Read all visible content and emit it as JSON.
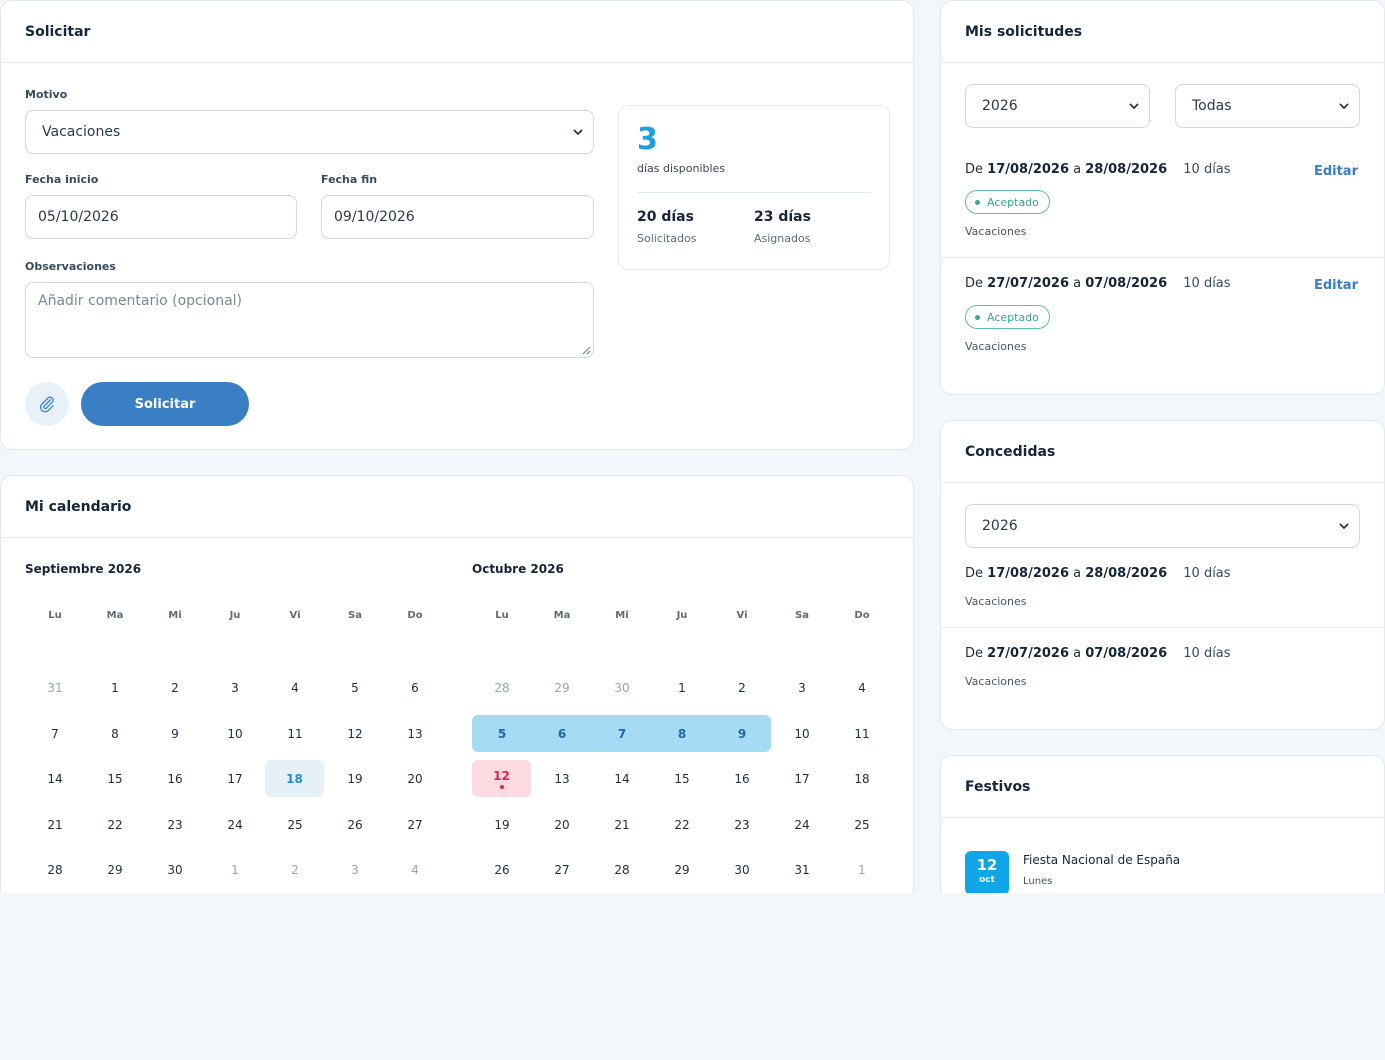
{
  "solicitar": {
    "title": "Solicitar",
    "motivo_label": "Motivo",
    "motivo_value": "Vacaciones",
    "fecha_inicio_label": "Fecha inicio",
    "fecha_inicio_value": "05/10/2026",
    "fecha_fin_label": "Fecha fin",
    "fecha_fin_value": "09/10/2026",
    "observaciones_label": "Observaciones",
    "observaciones_placeholder": "Añadir comentario (opcional)",
    "submit_label": "Solicitar"
  },
  "stats": {
    "available": "3",
    "available_label": "días disponibles",
    "requested": "20 días",
    "requested_label": "Solicitados",
    "assigned": "23 días",
    "assigned_label": "Asignados"
  },
  "calendar": {
    "title": "Mi calendario",
    "weekdays": [
      "Lu",
      "Ma",
      "Mi",
      "Ju",
      "Vi",
      "Sa",
      "Do"
    ],
    "months": [
      {
        "name": "Septiembre 2026",
        "weeks": [
          [
            "31",
            "1",
            "2",
            "3",
            "4",
            "5",
            "6"
          ],
          [
            "7",
            "8",
            "9",
            "10",
            "11",
            "12",
            "13"
          ],
          [
            "14",
            "15",
            "16",
            "17",
            "18",
            "19",
            "20"
          ],
          [
            "21",
            "22",
            "23",
            "24",
            "25",
            "26",
            "27"
          ],
          [
            "28",
            "29",
            "30",
            "1",
            "2",
            "3",
            "4"
          ]
        ]
      },
      {
        "name": "Octubre 2026",
        "weeks": [
          [
            "28",
            "29",
            "30",
            "1",
            "2",
            "3",
            "4"
          ],
          [
            "5",
            "6",
            "7",
            "8",
            "9",
            "10",
            "11"
          ],
          [
            "12",
            "13",
            "14",
            "15",
            "16",
            "17",
            "18"
          ],
          [
            "19",
            "20",
            "21",
            "22",
            "23",
            "24",
            "25"
          ],
          [
            "26",
            "27",
            "28",
            "29",
            "30",
            "31",
            "1"
          ]
        ]
      }
    ]
  },
  "mis_solicitudes": {
    "title": "Mis solicitudes",
    "year_filter": "2026",
    "status_filter": "Todas",
    "items": [
      {
        "prefix": "De",
        "start": "17/08/2026",
        "joiner": "a",
        "end": "28/08/2026",
        "days": "10 días",
        "status": "Aceptado",
        "motivo": "Vacaciones",
        "edit_label": "Editar"
      },
      {
        "prefix": "De",
        "start": "27/07/2026",
        "joiner": "a",
        "end": "07/08/2026",
        "days": "10 días",
        "status": "Aceptado",
        "motivo": "Vacaciones",
        "edit_label": "Editar"
      }
    ]
  },
  "concedidas": {
    "title": "Concedidas",
    "year_filter": "2026",
    "items": [
      {
        "prefix": "De",
        "start": "17/08/2026",
        "joiner": "a",
        "end": "28/08/2026",
        "days": "10 días",
        "motivo": "Vacaciones"
      },
      {
        "prefix": "De",
        "start": "27/07/2026",
        "joiner": "a",
        "end": "07/08/2026",
        "days": "10 días",
        "motivo": "Vacaciones"
      }
    ]
  },
  "festivos": {
    "title": "Festivos",
    "items": [
      {
        "day": "12",
        "month": "oct",
        "name": "Fiesta Nacional de España",
        "weekday": "Lunes"
      }
    ]
  },
  "colors": {
    "accent": "#3a7ec4",
    "available_number": "#1ba0e0",
    "selected_range": "#a6dcf3",
    "holiday": "#d2274e",
    "accepted": "#3aa592"
  }
}
